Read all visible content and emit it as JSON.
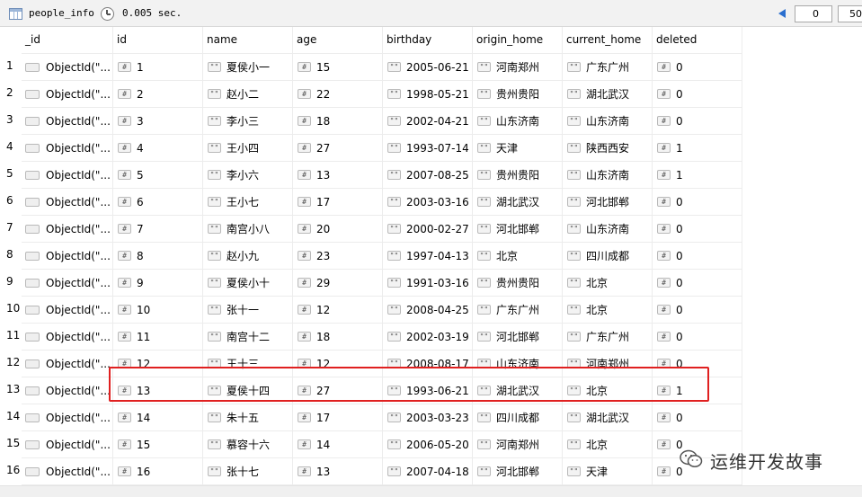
{
  "toolbar": {
    "collection_name": "people_info",
    "query_time": "0.005 sec.",
    "skip_value": "0",
    "limit_value": "50"
  },
  "columns": [
    "_id",
    "id",
    "name",
    "age",
    "birthday",
    "origin_home",
    "current_home",
    "deleted"
  ],
  "type_badges": {
    "object": "",
    "number": "#",
    "string": "\"\""
  },
  "rows": [
    {
      "n": "1",
      "oid": "ObjectId(\"...",
      "id": "1",
      "name": "夏侯小一",
      "age": "15",
      "birthday": "2005-06-21",
      "origin_home": "河南郑州",
      "current_home": "广东广州",
      "deleted": "0"
    },
    {
      "n": "2",
      "oid": "ObjectId(\"...",
      "id": "2",
      "name": "赵小二",
      "age": "22",
      "birthday": "1998-05-21",
      "origin_home": "贵州贵阳",
      "current_home": "湖北武汉",
      "deleted": "0"
    },
    {
      "n": "3",
      "oid": "ObjectId(\"...",
      "id": "3",
      "name": "李小三",
      "age": "18",
      "birthday": "2002-04-21",
      "origin_home": "山东济南",
      "current_home": "山东济南",
      "deleted": "0"
    },
    {
      "n": "4",
      "oid": "ObjectId(\"...",
      "id": "4",
      "name": "王小四",
      "age": "27",
      "birthday": "1993-07-14",
      "origin_home": "天津",
      "current_home": "陕西西安",
      "deleted": "1"
    },
    {
      "n": "5",
      "oid": "ObjectId(\"...",
      "id": "5",
      "name": "李小六",
      "age": "13",
      "birthday": "2007-08-25",
      "origin_home": "贵州贵阳",
      "current_home": "山东济南",
      "deleted": "1"
    },
    {
      "n": "6",
      "oid": "ObjectId(\"...",
      "id": "6",
      "name": "王小七",
      "age": "17",
      "birthday": "2003-03-16",
      "origin_home": "湖北武汉",
      "current_home": "河北邯郸",
      "deleted": "0"
    },
    {
      "n": "7",
      "oid": "ObjectId(\"...",
      "id": "7",
      "name": "南宫小八",
      "age": "20",
      "birthday": "2000-02-27",
      "origin_home": "河北邯郸",
      "current_home": "山东济南",
      "deleted": "0"
    },
    {
      "n": "8",
      "oid": "ObjectId(\"...",
      "id": "8",
      "name": "赵小九",
      "age": "23",
      "birthday": "1997-04-13",
      "origin_home": "北京",
      "current_home": "四川成都",
      "deleted": "0"
    },
    {
      "n": "9",
      "oid": "ObjectId(\"...",
      "id": "9",
      "name": "夏侯小十",
      "age": "29",
      "birthday": "1991-03-16",
      "origin_home": "贵州贵阳",
      "current_home": "北京",
      "deleted": "0"
    },
    {
      "n": "10",
      "oid": "ObjectId(\"...",
      "id": "10",
      "name": "张十一",
      "age": "12",
      "birthday": "2008-04-25",
      "origin_home": "广东广州",
      "current_home": "北京",
      "deleted": "0"
    },
    {
      "n": "11",
      "oid": "ObjectId(\"...",
      "id": "11",
      "name": "南宫十二",
      "age": "18",
      "birthday": "2002-03-19",
      "origin_home": "河北邯郸",
      "current_home": "广东广州",
      "deleted": "0"
    },
    {
      "n": "12",
      "oid": "ObjectId(\"...",
      "id": "12",
      "name": "王十三",
      "age": "12",
      "birthday": "2008-08-17",
      "origin_home": "山东济南",
      "current_home": "河南郑州",
      "deleted": "0"
    },
    {
      "n": "13",
      "oid": "ObjectId(\"...",
      "id": "13",
      "name": "夏侯十四",
      "age": "27",
      "birthday": "1993-06-21",
      "origin_home": "湖北武汉",
      "current_home": "北京",
      "deleted": "1"
    },
    {
      "n": "14",
      "oid": "ObjectId(\"...",
      "id": "14",
      "name": "朱十五",
      "age": "17",
      "birthday": "2003-03-23",
      "origin_home": "四川成都",
      "current_home": "湖北武汉",
      "deleted": "0"
    },
    {
      "n": "15",
      "oid": "ObjectId(\"...",
      "id": "15",
      "name": "慕容十六",
      "age": "14",
      "birthday": "2006-05-20",
      "origin_home": "河南郑州",
      "current_home": "北京",
      "deleted": "0"
    },
    {
      "n": "16",
      "oid": "ObjectId(\"...",
      "id": "16",
      "name": "张十七",
      "age": "13",
      "birthday": "2007-04-18",
      "origin_home": "河北邯郸",
      "current_home": "天津",
      "deleted": "0"
    }
  ],
  "highlighted_row": "13",
  "watermark": {
    "text": "运维开发故事",
    "icon": "wechat-icon"
  },
  "colors": {
    "highlight_border": "#e02020",
    "grid_line": "#ececec",
    "toolbar_bg": "#f2f2f2",
    "nav_arrow": "#2b6fcf"
  }
}
